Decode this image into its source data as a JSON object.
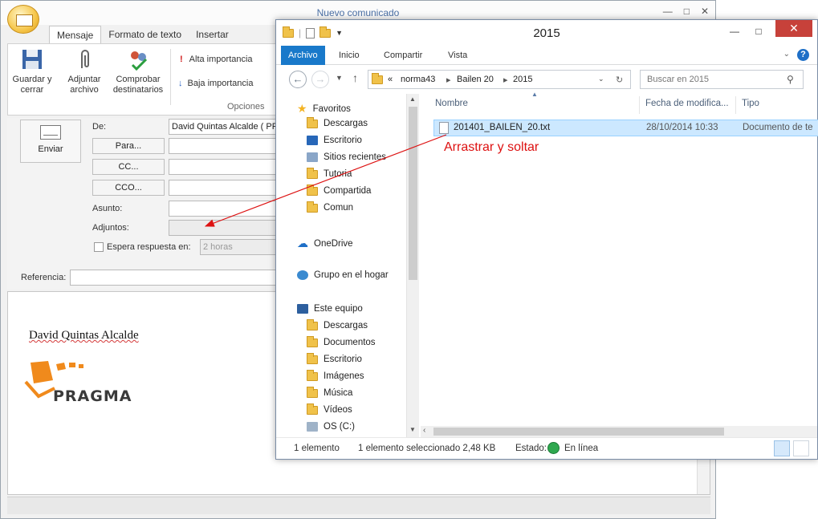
{
  "compose": {
    "title": "Nuevo comunicado",
    "tabs": [
      "Mensaje",
      "Formato de texto",
      "Insertar"
    ],
    "ribbon": {
      "save_close": "Guardar y cerrar",
      "attach": "Adjuntar archivo",
      "check_recipients": "Comprobar destinatarios",
      "high_importance": "Alta importancia",
      "low_importance": "Baja importancia",
      "options_group": "Opciones"
    },
    "send": "Enviar",
    "from_label": "De:",
    "from_value": "David Quintas Alcalde ( PRA",
    "to_button": "Para...",
    "cc_button": "CC...",
    "bcc_button": "CCO...",
    "subject_label": "Asunto:",
    "attachments_label": "Adjuntos:",
    "wait_reply_label": "Espera respuesta en:",
    "wait_reply_value": "2 horas",
    "reference_label": "Referencia:",
    "signature_name": "David Quintas Alcalde",
    "logo_text": "PRAGMA"
  },
  "explorer": {
    "title": "2015",
    "ribbon_tabs": [
      "Archivo",
      "Inicio",
      "Compartir",
      "Vista"
    ],
    "breadcrumb": [
      "norma43",
      "Bailen 20",
      "2015"
    ],
    "search_placeholder": "Buscar en 2015",
    "nav": {
      "favorites": "Favoritos",
      "favorites_items": [
        "Descargas",
        "Escritorio",
        "Sitios recientes",
        "Tutoria",
        "Compartida",
        "Comun"
      ],
      "onedrive": "OneDrive",
      "homegroup": "Grupo en el hogar",
      "this_pc": "Este equipo",
      "pc_items": [
        "Descargas",
        "Documentos",
        "Escritorio",
        "Imágenes",
        "Música",
        "Vídeos",
        "OS (C:)"
      ]
    },
    "columns": [
      "Nombre",
      "Fecha de modifica...",
      "Tipo"
    ],
    "file": {
      "name": "201401_BAILEN_20.txt",
      "date": "28/10/2014 10:33",
      "type": "Documento de te"
    },
    "status": {
      "count": "1 elemento",
      "selected": "1 elemento seleccionado  2,48 KB",
      "state_label": "Estado:",
      "state_value": "En línea"
    }
  },
  "annotation": "Arrastrar y soltar",
  "colors": {
    "accent": "#1979ca",
    "selection": "#cce8ff",
    "annotation": "#dd1111",
    "close": "#c7413a"
  }
}
